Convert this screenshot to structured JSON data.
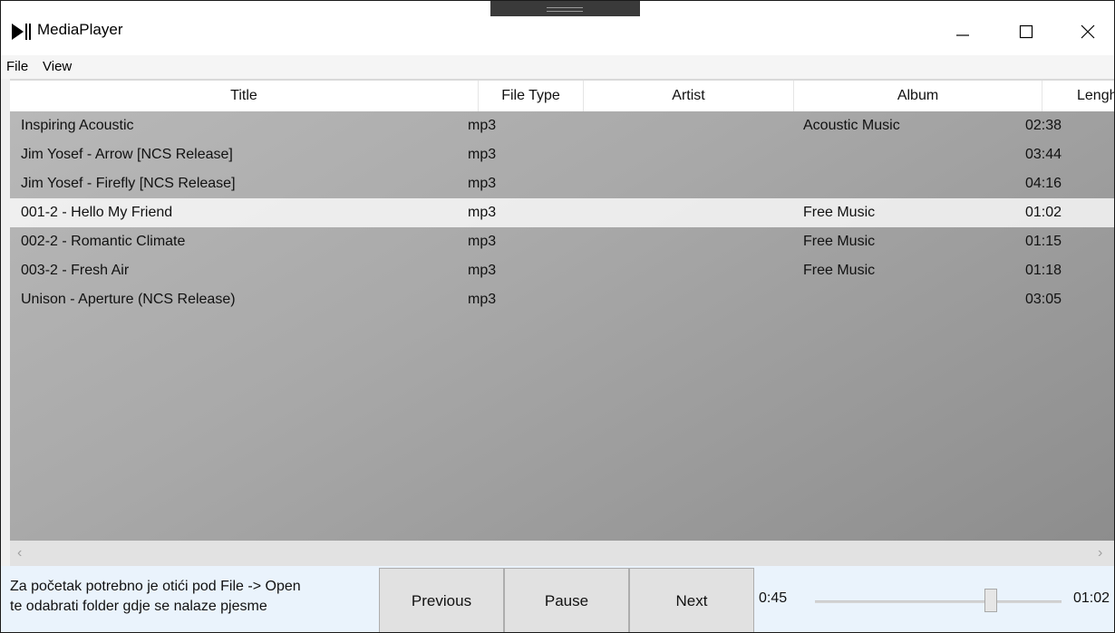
{
  "window": {
    "title": "MediaPlayer",
    "controls": [
      "minimize-icon",
      "maximize-icon",
      "close-icon"
    ]
  },
  "menu": {
    "file": "File",
    "view": "View"
  },
  "table": {
    "columns": {
      "title": "Title",
      "file_type": "File Type",
      "artist": "Artist",
      "album": "Album",
      "length": "Lenght"
    },
    "rows": [
      {
        "title": "Inspiring Acoustic",
        "file_type": "mp3",
        "artist": "",
        "album": "Acoustic Music",
        "length": "02:38"
      },
      {
        "title": "Jim Yosef - Arrow [NCS Release]",
        "file_type": "mp3",
        "artist": "",
        "album": "",
        "length": "03:44"
      },
      {
        "title": "Jim Yosef - Firefly [NCS Release]",
        "file_type": "mp3",
        "artist": "",
        "album": "",
        "length": "04:16"
      },
      {
        "title": "001-2 - Hello My Friend",
        "file_type": "mp3",
        "artist": "",
        "album": "Free Music",
        "length": "01:02"
      },
      {
        "title": "002-2 - Romantic Climate",
        "file_type": "mp3",
        "artist": "",
        "album": "Free Music",
        "length": "01:15"
      },
      {
        "title": "003-2 - Fresh Air",
        "file_type": "mp3",
        "artist": "",
        "album": "Free Music",
        "length": "01:18"
      },
      {
        "title": "Unison - Aperture (NCS Release)",
        "file_type": "mp3",
        "artist": "",
        "album": "",
        "length": "03:05"
      }
    ],
    "selected_index": 3
  },
  "footer": {
    "hint_line1": "Za početak potrebno je otići pod File -> Open",
    "hint_line2": "te odabrati folder gdje se nalaze pjesme",
    "previous": "Previous",
    "pause": "Pause",
    "next": "Next",
    "current_time": "0:45",
    "total_time": "01:02",
    "progress_fraction": 0.726
  },
  "colors": {
    "selected_row": "#f2f2f2",
    "bottom_bar": "#eaf3fc",
    "button": "#e1e1e1"
  }
}
